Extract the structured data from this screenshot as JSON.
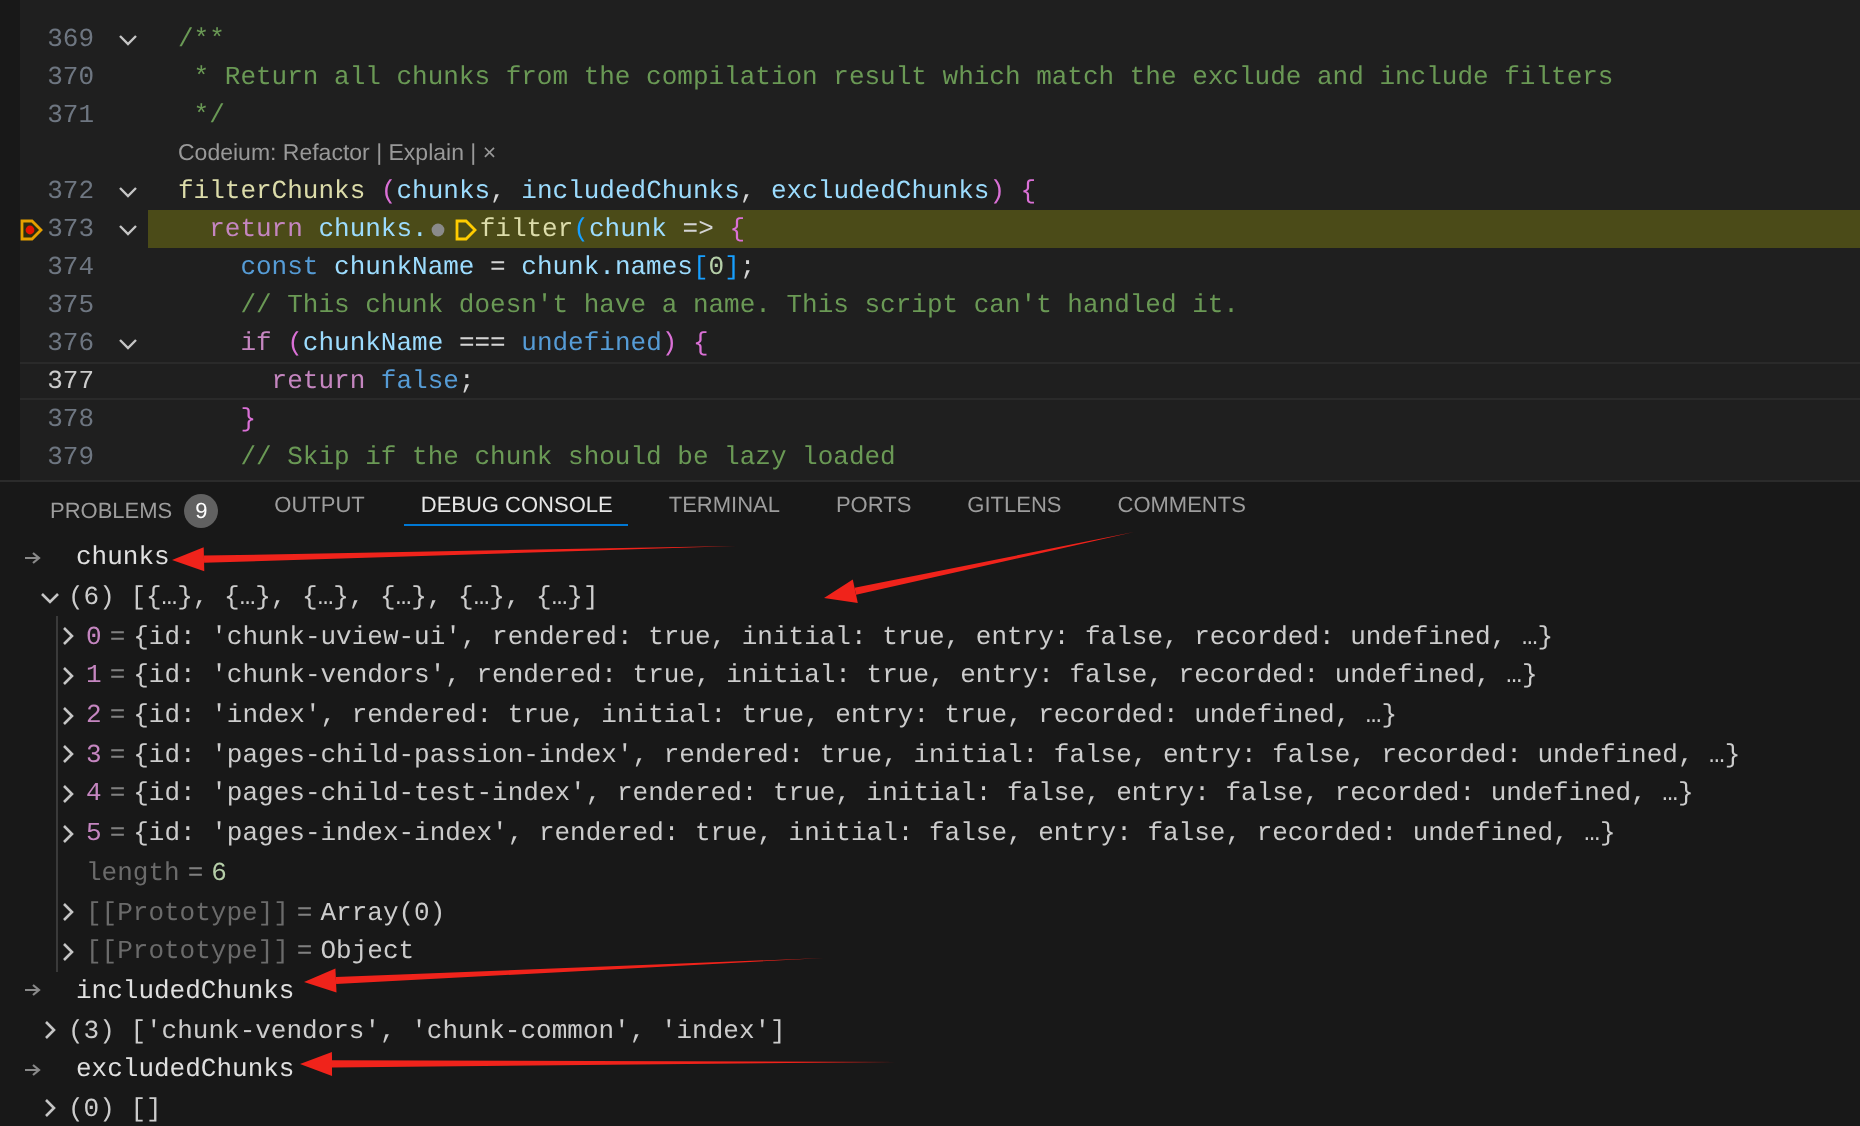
{
  "editor": {
    "lines": [
      {
        "number": "369",
        "fold": true,
        "paused": false,
        "cursor": false,
        "tokens": [
          {
            "text": "/**",
            "kind": "comment"
          }
        ]
      },
      {
        "number": "370",
        "fold": false,
        "paused": false,
        "cursor": false,
        "tokens": [
          {
            "text": " * Return all chunks from the compilation result which match the exclude and include filters",
            "kind": "comment"
          }
        ]
      },
      {
        "number": "371",
        "fold": false,
        "paused": false,
        "cursor": false,
        "tokens": [
          {
            "text": " */",
            "kind": "comment"
          }
        ]
      },
      {
        "kind": "lens",
        "text": "Codeium: Refactor | Explain | ×"
      },
      {
        "number": "372",
        "fold": true,
        "paused": false,
        "cursor": false,
        "tokens": [
          {
            "text": "filterChunks",
            "kind": "func"
          },
          {
            "text": " (",
            "kind": "bracket"
          },
          {
            "text": "chunks",
            "kind": "var"
          },
          {
            "text": ", ",
            "kind": "plain"
          },
          {
            "text": "includedChunks",
            "kind": "var"
          },
          {
            "text": ", ",
            "kind": "plain"
          },
          {
            "text": "excludedChunks",
            "kind": "var"
          },
          {
            "text": ") {",
            "kind": "bracket"
          }
        ]
      },
      {
        "number": "373",
        "fold": true,
        "paused": true,
        "cursor": false,
        "tokens": [
          {
            "text": "  return",
            "kind": "keyword"
          },
          {
            "text": " chunks.",
            "kind": "var"
          },
          {
            "kind": "frame"
          },
          {
            "text": "filter",
            "kind": "func"
          },
          {
            "text": "(",
            "kind": "bracket2"
          },
          {
            "text": "chunk",
            "kind": "var"
          },
          {
            "text": " => ",
            "kind": "op"
          },
          {
            "text": "{",
            "kind": "bracket"
          }
        ]
      },
      {
        "number": "374",
        "fold": false,
        "paused": false,
        "cursor": false,
        "tokens": [
          {
            "text": "    const",
            "kind": "storage"
          },
          {
            "text": " chunkName",
            "kind": "var"
          },
          {
            "text": " = ",
            "kind": "plain"
          },
          {
            "text": "chunk.names",
            "kind": "var"
          },
          {
            "text": "[",
            "kind": "bracket2"
          },
          {
            "text": "0",
            "kind": "number"
          },
          {
            "text": "]",
            "kind": "bracket2"
          },
          {
            "text": ";",
            "kind": "plain"
          }
        ]
      },
      {
        "number": "375",
        "fold": false,
        "paused": false,
        "cursor": false,
        "tokens": [
          {
            "text": "    // This chunk doesn't have a name. This script can't handled it.",
            "kind": "comment"
          }
        ]
      },
      {
        "number": "376",
        "fold": true,
        "paused": false,
        "cursor": false,
        "tokens": [
          {
            "text": "    if",
            "kind": "keyword"
          },
          {
            "text": " (",
            "kind": "bracket"
          },
          {
            "text": "chunkName",
            "kind": "var"
          },
          {
            "text": " === ",
            "kind": "plain"
          },
          {
            "text": "undefined",
            "kind": "storage"
          },
          {
            "text": ") {",
            "kind": "bracket"
          }
        ]
      },
      {
        "number": "377",
        "fold": false,
        "paused": false,
        "cursor": true,
        "tokens": [
          {
            "text": "      return",
            "kind": "keyword"
          },
          {
            "text": " false",
            "kind": "storage"
          },
          {
            "text": ";",
            "kind": "plain"
          }
        ]
      },
      {
        "number": "378",
        "fold": false,
        "paused": false,
        "cursor": false,
        "tokens": [
          {
            "text": "    }",
            "kind": "bracket"
          }
        ]
      },
      {
        "number": "379",
        "fold": false,
        "paused": false,
        "cursor": false,
        "tokens": [
          {
            "text": "    // Skip if the chunk should be lazy loaded",
            "kind": "comment"
          }
        ]
      }
    ]
  },
  "panel": {
    "tabs": [
      {
        "label": "PROBLEMS",
        "badge": "9",
        "selected": false
      },
      {
        "label": "OUTPUT",
        "selected": false
      },
      {
        "label": "DEBUG CONSOLE",
        "selected": true
      },
      {
        "label": "TERMINAL",
        "selected": false
      },
      {
        "label": "PORTS",
        "selected": false
      },
      {
        "label": "GITLENS",
        "selected": false
      },
      {
        "label": "COMMENTS",
        "selected": false
      }
    ],
    "console": [
      {
        "kind": "input",
        "text": "chunks"
      },
      {
        "kind": "value",
        "text": "(6) [{…}, {…}, {…}, {…}, {…}, {…}]",
        "expanded": true,
        "children": [
          {
            "kind": "entry",
            "key": "0",
            "sep": "=",
            "value": "{id: 'chunk-uview-ui', rendered: true, initial: true, entry: false, recorded: undefined, …}",
            "expanded": false
          },
          {
            "kind": "entry",
            "key": "1",
            "sep": "=",
            "value": "{id: 'chunk-vendors', rendered: true, initial: true, entry: false, recorded: undefined, …}",
            "expanded": false
          },
          {
            "kind": "entry",
            "key": "2",
            "sep": "=",
            "value": "{id: 'index', rendered: true, initial: true, entry: true, recorded: undefined, …}",
            "expanded": false
          },
          {
            "kind": "entry",
            "key": "3",
            "sep": "=",
            "value": "{id: 'pages-child-passion-index', rendered: true, initial: false, entry: false, recorded: undefined, …}",
            "expanded": false
          },
          {
            "kind": "entry",
            "key": "4",
            "sep": "=",
            "value": "{id: 'pages-child-test-index', rendered: true, initial: false, entry: false, recorded: undefined, …}",
            "expanded": false
          },
          {
            "kind": "entry",
            "key": "5",
            "sep": "=",
            "value": "{id: 'pages-index-index', rendered: true, initial: false, entry: false, recorded: undefined, …}",
            "expanded": false
          },
          {
            "kind": "property",
            "key": "length",
            "sep": "=",
            "value": "6"
          },
          {
            "kind": "internal",
            "key": "[[Prototype]]",
            "sep": "=",
            "value": "Array(0)",
            "expanded": false
          },
          {
            "kind": "internal",
            "key": "[[Prototype]]",
            "sep": "=",
            "value": "Object",
            "expanded": false
          }
        ]
      },
      {
        "kind": "input",
        "text": "includedChunks"
      },
      {
        "kind": "value",
        "text": "(3) ['chunk-vendors', 'chunk-common', 'index']",
        "expanded": false
      },
      {
        "kind": "input",
        "text": "excludedChunks"
      },
      {
        "kind": "value",
        "text": "(0) []",
        "expanded": false
      }
    ]
  }
}
